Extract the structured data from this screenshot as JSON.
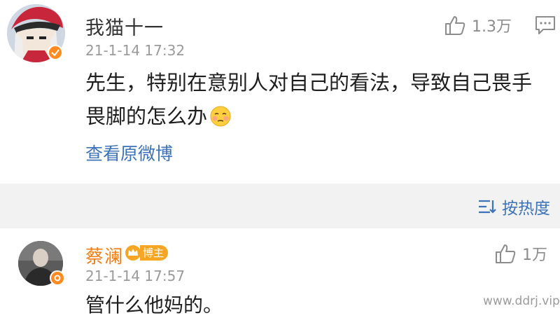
{
  "post": {
    "username": "我猫十一",
    "timestamp": "21-1-14 17:32",
    "likes": "1.3万",
    "body": "先生，特别在意别人对自己的看法，导致自己畏手畏脚的怎么办",
    "emoji": "flushed-face-icon",
    "view_original": "查看原微博"
  },
  "sort": {
    "label": "按热度",
    "icon": "sort-icon"
  },
  "reply": {
    "username": "蔡澜",
    "badge": "博主",
    "timestamp": "21-1-14 17:57",
    "likes": "1万",
    "body": "管什么他妈的。"
  },
  "watermark": "www.ddrj.vip",
  "colors": {
    "link": "#3c73b8",
    "host_name": "#f07c12",
    "verified_badge": "#ff8a1f",
    "section_bg": "#f2f2f2"
  }
}
